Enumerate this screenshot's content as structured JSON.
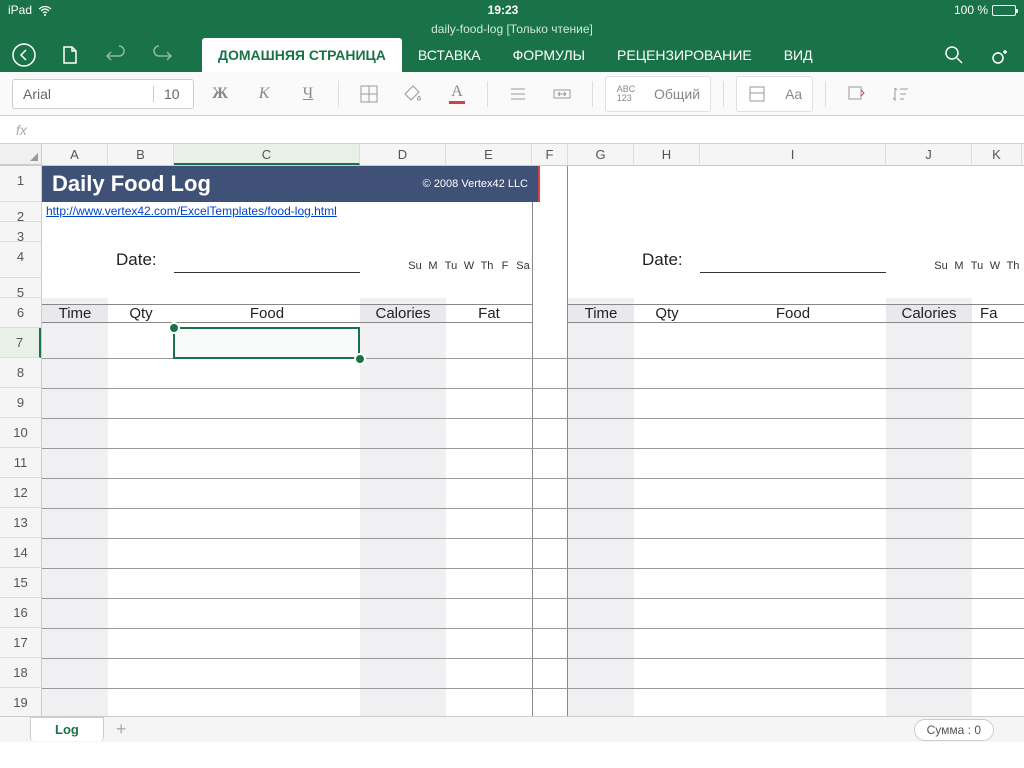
{
  "status": {
    "device": "iPad",
    "time": "19:23",
    "battery": "100 %"
  },
  "doc": {
    "title": "daily-food-log [Только чтение]"
  },
  "tabs": {
    "home": "ДОМАШНЯЯ СТРАНИЦА",
    "insert": "ВСТАВКА",
    "formulas": "ФОРМУЛЫ",
    "review": "РЕЦЕНЗИРОВАНИЕ",
    "view": "ВИД"
  },
  "toolbar": {
    "font": "Arial",
    "size": "10",
    "format": "Общий",
    "aa": "Aa"
  },
  "fx": "fx",
  "cols": [
    "A",
    "B",
    "C",
    "D",
    "E",
    "F",
    "G",
    "H",
    "I",
    "J",
    "K"
  ],
  "rows": [
    "1",
    "2",
    "3",
    "4",
    "5",
    "6",
    "7",
    "8",
    "9",
    "10",
    "11",
    "12",
    "13",
    "14",
    "15",
    "16",
    "17",
    "18",
    "19"
  ],
  "sheet": {
    "title": "Daily Food Log",
    "copyright": "© 2008 Vertex42 LLC",
    "link": "http://www.vertex42.com/ExcelTemplates/food-log.html",
    "date_label": "Date:",
    "days": [
      "Su",
      "M",
      "Tu",
      "W",
      "Th",
      "F",
      "Sa"
    ],
    "days2": [
      "Su",
      "M",
      "Tu",
      "W",
      "Th"
    ],
    "headers": {
      "time": "Time",
      "qty": "Qty",
      "food": "Food",
      "calories": "Calories",
      "fat": "Fat",
      "fa": "Fa"
    }
  },
  "sheet_tab": "Log",
  "sum": "Сумма : 0"
}
